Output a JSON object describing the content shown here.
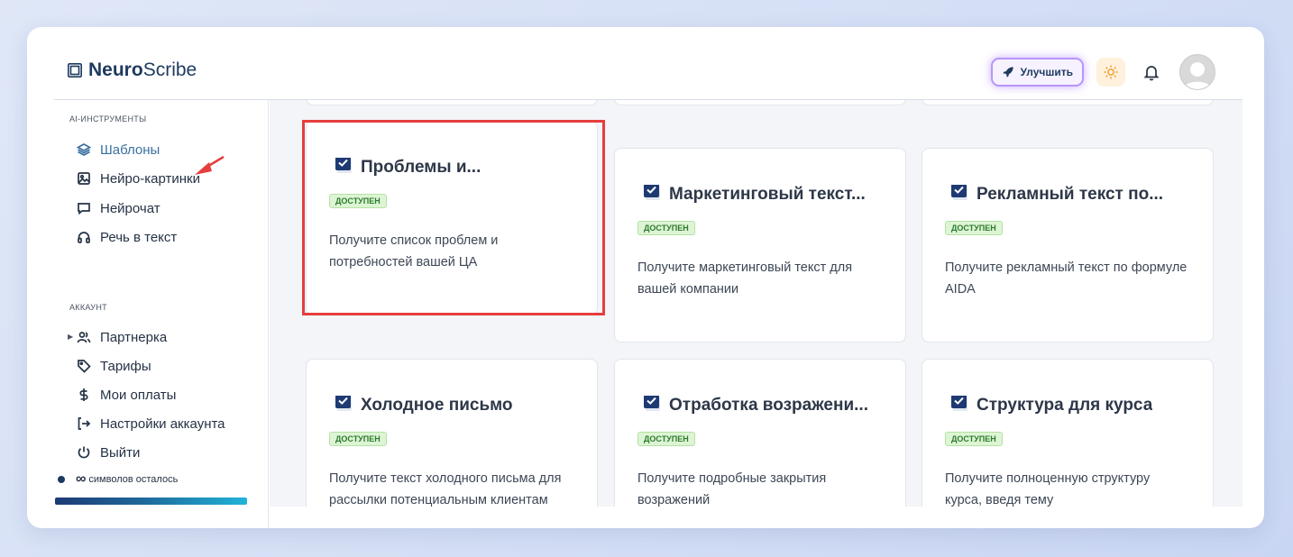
{
  "app": {
    "name_bold": "Neuro",
    "name_light": "Scribe"
  },
  "header": {
    "upgrade_label": "Улучшить"
  },
  "sidebar": {
    "section_ai": "AI-ИНСТРУМЕНТЫ",
    "ai_items": [
      {
        "label": "Шаблоны",
        "icon": "layers-icon",
        "active": true
      },
      {
        "label": "Нейро-картинки",
        "icon": "image-icon"
      },
      {
        "label": "Нейрочат",
        "icon": "chat-icon"
      },
      {
        "label": "Речь в текст",
        "icon": "headphones-icon"
      }
    ],
    "section_account": "АККАУНТ",
    "account_items": [
      {
        "label": "Партнерка",
        "icon": "users-icon"
      },
      {
        "label": "Тарифы",
        "icon": "tag-icon"
      },
      {
        "label": "Мои оплаты",
        "icon": "dollar-icon"
      },
      {
        "label": "Настройки аккаунта",
        "icon": "login-icon"
      },
      {
        "label": "Выйти",
        "icon": "power-icon"
      }
    ],
    "symbols_value": "∞",
    "symbols_label": "символов осталось"
  },
  "cards": [
    {
      "title": "Проблемы и...",
      "badge": "ДОСТУПЕН",
      "description": "Получите список проблем и потребностей вашей ЦА"
    },
    {
      "title": "Маркетинговый текст...",
      "badge": "ДОСТУПЕН",
      "description": "Получите маркетинговый текст для вашей компании"
    },
    {
      "title": "Рекламный текст по...",
      "badge": "ДОСТУПЕН",
      "description": "Получите рекламный текст по формуле AIDA"
    },
    {
      "title": "Холодное письмо",
      "badge": "ДОСТУПЕН",
      "description": "Получите текст холодного письма для рассылки потенциальным клиентам"
    },
    {
      "title": "Отработка возражени...",
      "badge": "ДОСТУПЕН",
      "description": "Получите подробные закрытия возражений"
    },
    {
      "title": "Структура для курса",
      "badge": "ДОСТУПЕН",
      "description": "Получите полноценную структуру курса, введя тему"
    }
  ],
  "colors": {
    "accent": "#3a6fa0",
    "highlight": "#e53e3e",
    "badge_bg": "#ddf5d4",
    "badge_text": "#2f7a2f"
  }
}
